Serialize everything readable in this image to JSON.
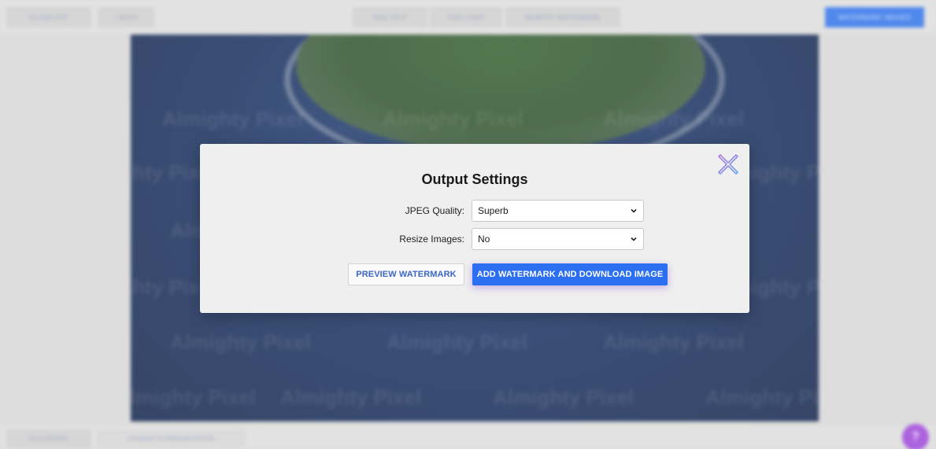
{
  "background": {
    "topbar": {
      "close_app": "CLOSE APP",
      "back": "< BACK",
      "add_text": "ADD TEXT",
      "add_logo": "ADD LOGO",
      "remove_watermark": "REMOVE WATERMARK",
      "watermark_images": "WATERMARK IMAGES"
    },
    "watermark_text": "Almighty Pixel",
    "bottombar": {
      "plan": "PLUS EDITION",
      "upgrade": "UPGRADE TO PREMIUM EDITION"
    },
    "help_label": "?"
  },
  "modal": {
    "title": "Output Settings",
    "jpeg_quality": {
      "label": "JPEG Quality:",
      "value": "Superb"
    },
    "resize_images": {
      "label": "Resize Images:",
      "value": "No"
    },
    "preview_button": "PREVIEW WATERMARK",
    "download_button": "ADD WATERMARK AND DOWNLOAD IMAGE",
    "close_icon": "close-x-icon"
  },
  "colors": {
    "primary": "#2b6ef2",
    "help": "#9a3fd6",
    "close_icon_gradient": [
      "#b07ad8",
      "#6fa3e8"
    ]
  }
}
